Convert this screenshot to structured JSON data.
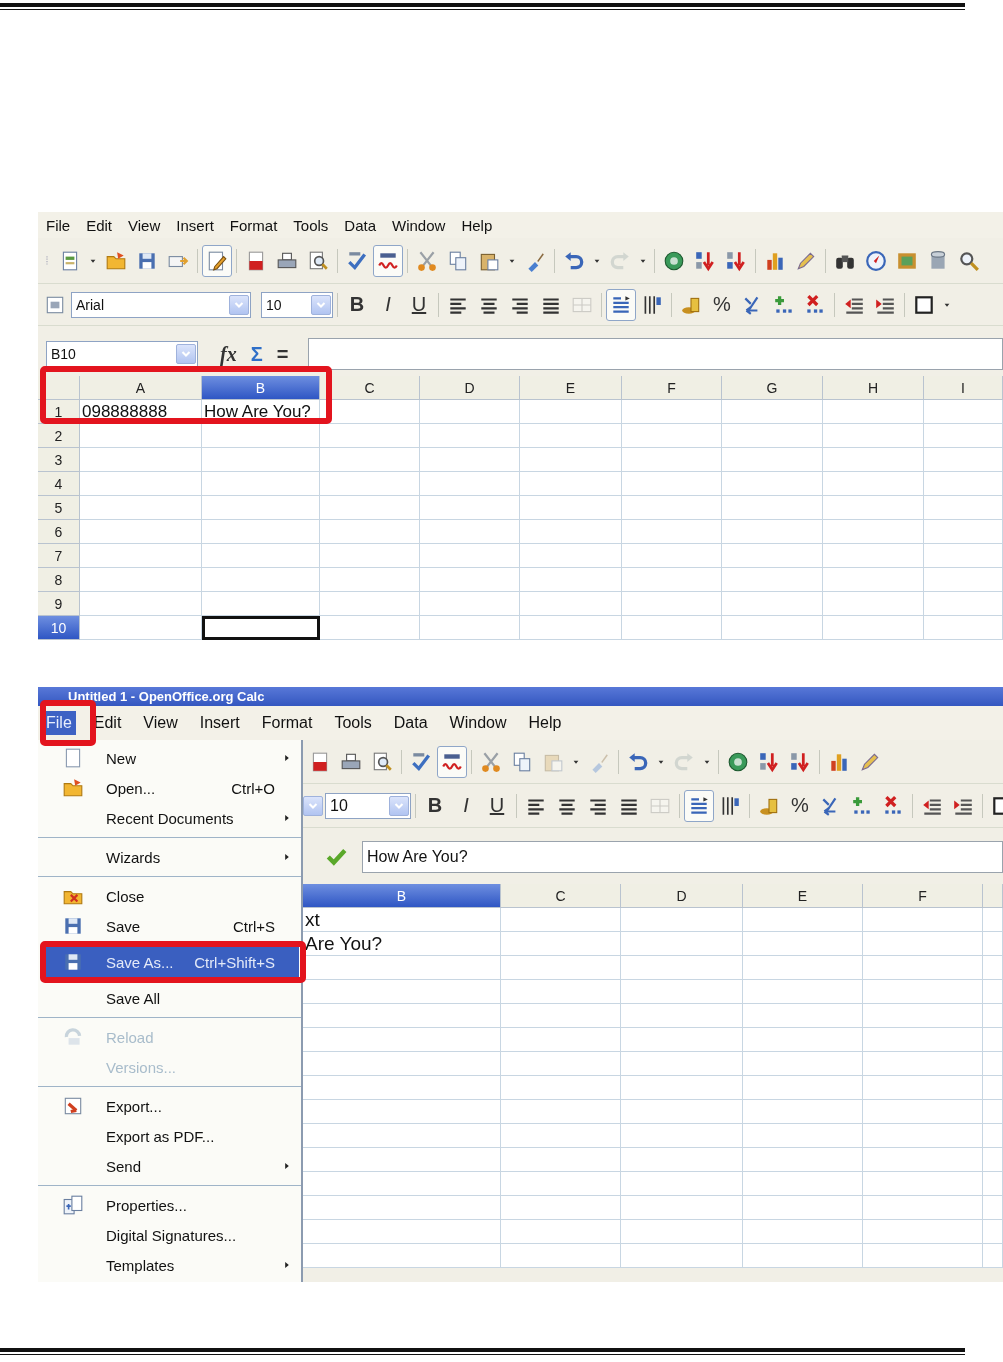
{
  "screenshot_1": {
    "menu": [
      "File",
      "Edit",
      "View",
      "Insert",
      "Format",
      "Tools",
      "Data",
      "Window",
      "Help"
    ],
    "tools": {
      "edit_mode": {
        "pressed": true,
        "disabled": false
      },
      "auto_spellcheck": {
        "pressed": true,
        "disabled": false
      },
      "wrap_text": {
        "pressed": true,
        "disabled": false
      },
      "redo": {
        "pressed": false,
        "disabled": true
      },
      "merge_cells": {
        "pressed": false,
        "disabled": true
      }
    },
    "font_name": "Arial",
    "font_size": "10",
    "format_buttons": [
      "B",
      "I",
      "U"
    ],
    "percent": "%",
    "cell_ref": "B10",
    "formula_buttons": [
      "fx",
      "Σ",
      "="
    ],
    "columns": [
      {
        "label": "A",
        "selected": false
      },
      {
        "label": "B",
        "selected": true
      },
      {
        "label": "C",
        "selected": false
      },
      {
        "label": "D",
        "selected": false
      },
      {
        "label": "E",
        "selected": false
      },
      {
        "label": "F",
        "selected": false
      },
      {
        "label": "G",
        "selected": false
      },
      {
        "label": "H",
        "selected": false
      },
      {
        "label": "I",
        "selected": false
      }
    ],
    "rows": [
      {
        "label": "1",
        "selected": false,
        "cells": [
          "098888888",
          "How Are You?"
        ]
      },
      {
        "label": "2",
        "selected": false,
        "cells": []
      },
      {
        "label": "3",
        "selected": false,
        "cells": []
      },
      {
        "label": "4",
        "selected": false,
        "cells": []
      },
      {
        "label": "5",
        "selected": false,
        "cells": []
      },
      {
        "label": "6",
        "selected": false,
        "cells": []
      },
      {
        "label": "7",
        "selected": false,
        "cells": []
      },
      {
        "label": "8",
        "selected": false,
        "cells": []
      },
      {
        "label": "9",
        "selected": false,
        "cells": []
      },
      {
        "label": "10",
        "selected": true,
        "cells": []
      }
    ]
  },
  "screenshot_2": {
    "title": "Untitled 1 - OpenOffice.org Calc",
    "menu": [
      {
        "label": "File",
        "selected": true
      },
      {
        "label": "Edit",
        "selected": false
      },
      {
        "label": "View",
        "selected": false
      },
      {
        "label": "Insert",
        "selected": false
      },
      {
        "label": "Format",
        "selected": false
      },
      {
        "label": "Tools",
        "selected": false
      },
      {
        "label": "Data",
        "selected": false
      },
      {
        "label": "Window",
        "selected": false
      },
      {
        "label": "Help",
        "selected": false
      }
    ],
    "file_menu": [
      [
        {
          "label": "New",
          "submenu": true,
          "disabled": false,
          "selected": false
        },
        {
          "label": "Open...",
          "shortcut": "Ctrl+O",
          "submenu": false,
          "disabled": false,
          "selected": false
        },
        {
          "label": "Recent Documents",
          "submenu": true,
          "disabled": false,
          "selected": false
        }
      ],
      [
        {
          "label": "Wizards",
          "submenu": true,
          "disabled": false,
          "selected": false
        }
      ],
      [
        {
          "label": "Close",
          "submenu": false,
          "disabled": false,
          "selected": false
        },
        {
          "label": "Save",
          "shortcut": "Ctrl+S",
          "submenu": false,
          "disabled": false,
          "selected": false
        },
        {
          "label": "Save As...",
          "shortcut": "Ctrl+Shift+S",
          "submenu": false,
          "disabled": false,
          "selected": true
        },
        {
          "label": "Save All",
          "submenu": false,
          "disabled": false,
          "selected": false
        }
      ],
      [
        {
          "label": "Reload",
          "submenu": false,
          "disabled": true,
          "selected": false
        },
        {
          "label": "Versions...",
          "submenu": false,
          "disabled": true,
          "selected": false
        }
      ],
      [
        {
          "label": "Export...",
          "submenu": false,
          "disabled": false,
          "selected": false
        },
        {
          "label": "Export as PDF...",
          "submenu": false,
          "disabled": false,
          "selected": false
        },
        {
          "label": "Send",
          "submenu": true,
          "disabled": false,
          "selected": false
        }
      ],
      [
        {
          "label": "Properties...",
          "submenu": false,
          "disabled": false,
          "selected": false
        },
        {
          "label": "Digital Signatures...",
          "submenu": false,
          "disabled": false,
          "selected": false
        },
        {
          "label": "Templates",
          "submenu": true,
          "disabled": false,
          "selected": false
        }
      ]
    ],
    "tools": {
      "auto_spellcheck": {
        "pressed": true,
        "disabled": false
      },
      "wrap_text": {
        "pressed": true,
        "disabled": false
      },
      "paste": {
        "pressed": false,
        "disabled": true
      },
      "brush": {
        "pressed": false,
        "disabled": true
      },
      "redo": {
        "pressed": false,
        "disabled": true
      },
      "merge_cells": {
        "pressed": false,
        "disabled": true
      }
    },
    "font_size": "10",
    "format_buttons": [
      "B",
      "I",
      "U"
    ],
    "percent": "%",
    "formula": "How Are You?",
    "columns": [
      {
        "label": "B",
        "selected": true
      },
      {
        "label": "C",
        "selected": false
      },
      {
        "label": "D",
        "selected": false
      },
      {
        "label": "E",
        "selected": false
      },
      {
        "label": "F",
        "selected": false
      }
    ],
    "rows": [
      {
        "cells": [
          "xt"
        ]
      },
      {
        "cells": [
          "Are You?"
        ]
      }
    ]
  }
}
